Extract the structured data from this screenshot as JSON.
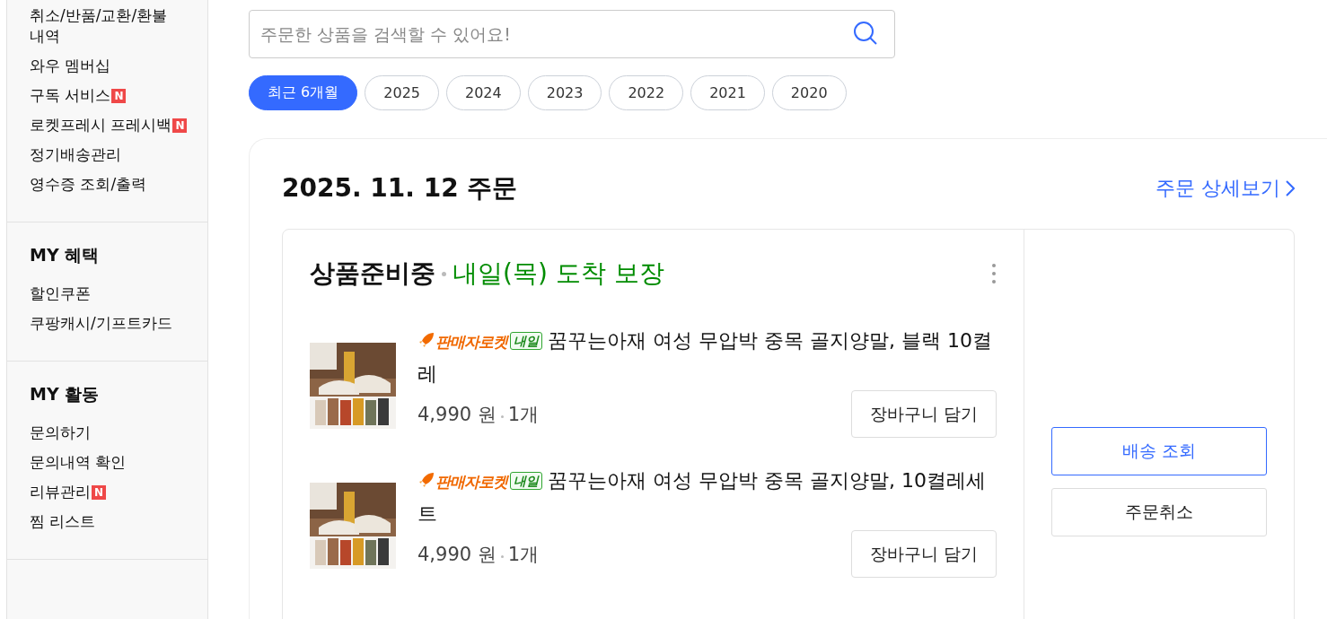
{
  "sidebar": {
    "groups": [
      {
        "items": [
          {
            "label": "취소/반품/교환/환불 내역"
          },
          {
            "label": "와우 멤버십"
          },
          {
            "label": "구독 서비스",
            "badge": "N"
          },
          {
            "label": "로켓프레시 프레시백",
            "badge": "N"
          },
          {
            "label": "정기배송관리"
          },
          {
            "label": "영수증 조회/출력"
          }
        ]
      },
      {
        "title": "MY 혜택",
        "items": [
          {
            "label": "할인쿠폰"
          },
          {
            "label": "쿠팡캐시/기프트카드"
          }
        ]
      },
      {
        "title": "MY 활동",
        "items": [
          {
            "label": "문의하기"
          },
          {
            "label": "문의내역 확인"
          },
          {
            "label": "리뷰관리",
            "badge": "N"
          },
          {
            "label": "찜 리스트"
          }
        ]
      }
    ]
  },
  "search": {
    "placeholder": "주문한 상품을 검색할 수 있어요!"
  },
  "periods": [
    {
      "label": "최근 6개월",
      "selected": true
    },
    {
      "label": "2025",
      "selected": false
    },
    {
      "label": "2024",
      "selected": false
    },
    {
      "label": "2023",
      "selected": false
    },
    {
      "label": "2022",
      "selected": false
    },
    {
      "label": "2021",
      "selected": false
    },
    {
      "label": "2020",
      "selected": false
    }
  ],
  "order": {
    "date": "2025. 11. 12 주문",
    "detail_link": "주문 상세보기",
    "status": "상품준비중",
    "delivery": "내일(목) 도착 보장",
    "items": [
      {
        "seller_badge": "판매자로켓",
        "day_badge": "내일",
        "name": "꿈꾸는아재 여성 무압박 중목 골지양말, 블랙 10켤레",
        "price": "4,990 원",
        "quantity": "1개",
        "cart_button": "장바구니 담기"
      },
      {
        "seller_badge": "판매자로켓",
        "day_badge": "내일",
        "name": "꿈꾸는아재 여성 무압박 중목 골지양말, 10켤레세트",
        "price": "4,990 원",
        "quantity": "1개",
        "cart_button": "장바구니 담기"
      }
    ],
    "actions": [
      {
        "label": "배송 조회",
        "kind": "primary"
      },
      {
        "label": "주문취소",
        "kind": "default"
      }
    ]
  }
}
